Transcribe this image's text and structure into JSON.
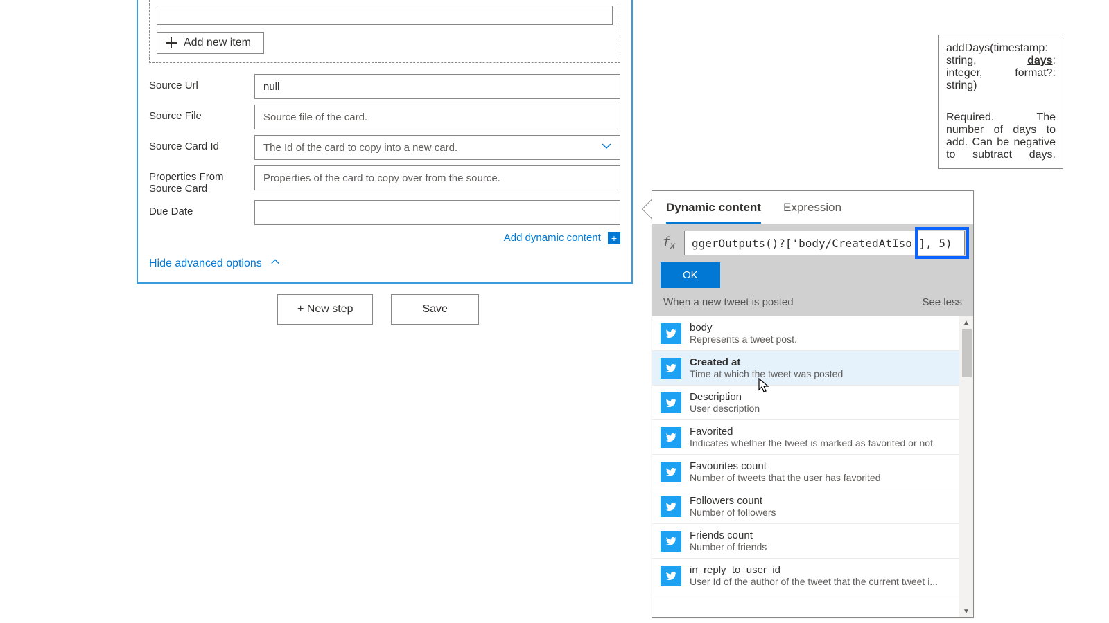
{
  "card": {
    "add_item_label": "Add new item",
    "source_url_label": "Source Url",
    "source_url_value": "null",
    "source_file_label": "Source File",
    "source_file_placeholder": "Source file of the card.",
    "source_card_id_label": "Source Card Id",
    "source_card_id_placeholder": "The Id of the card to copy into a new card.",
    "props_source_label": "Properties From Source Card",
    "props_source_placeholder": "Properties of the card to copy over from the source.",
    "due_date_label": "Due Date",
    "add_dynamic_label": "Add dynamic content",
    "hide_advanced_label": "Hide advanced options"
  },
  "actions": {
    "new_step": "+ New step",
    "save": "Save"
  },
  "tooltip": {
    "sig_line1": "addDays(timestamp:",
    "sig_line2a": "string,",
    "sig_line2b": "days",
    "sig_line2c": ":",
    "sig_line3": "integer, format?:",
    "sig_line4": "string)",
    "desc": "Required. The number of days to add. Can be negative to subtract days."
  },
  "dc": {
    "tab_dynamic": "Dynamic content",
    "tab_expression": "Expression",
    "fx_value": "ggerOutputs()?['body/CreatedAtIso'], 5)",
    "ok": "OK",
    "section_title": "When a new tweet is posted",
    "see_less": "See less",
    "items": [
      {
        "title": "body",
        "desc": "Represents a tweet post."
      },
      {
        "title": "Created at",
        "desc": "Time at which the tweet was posted"
      },
      {
        "title": "Description",
        "desc": "User description"
      },
      {
        "title": "Favorited",
        "desc": "Indicates whether the tweet is marked as favorited or not"
      },
      {
        "title": "Favourites count",
        "desc": "Number of tweets that the user has favorited"
      },
      {
        "title": "Followers count",
        "desc": "Number of followers"
      },
      {
        "title": "Friends count",
        "desc": "Number of friends"
      },
      {
        "title": "in_reply_to_user_id",
        "desc": "User Id of the author of the tweet that the current tweet i..."
      }
    ]
  }
}
